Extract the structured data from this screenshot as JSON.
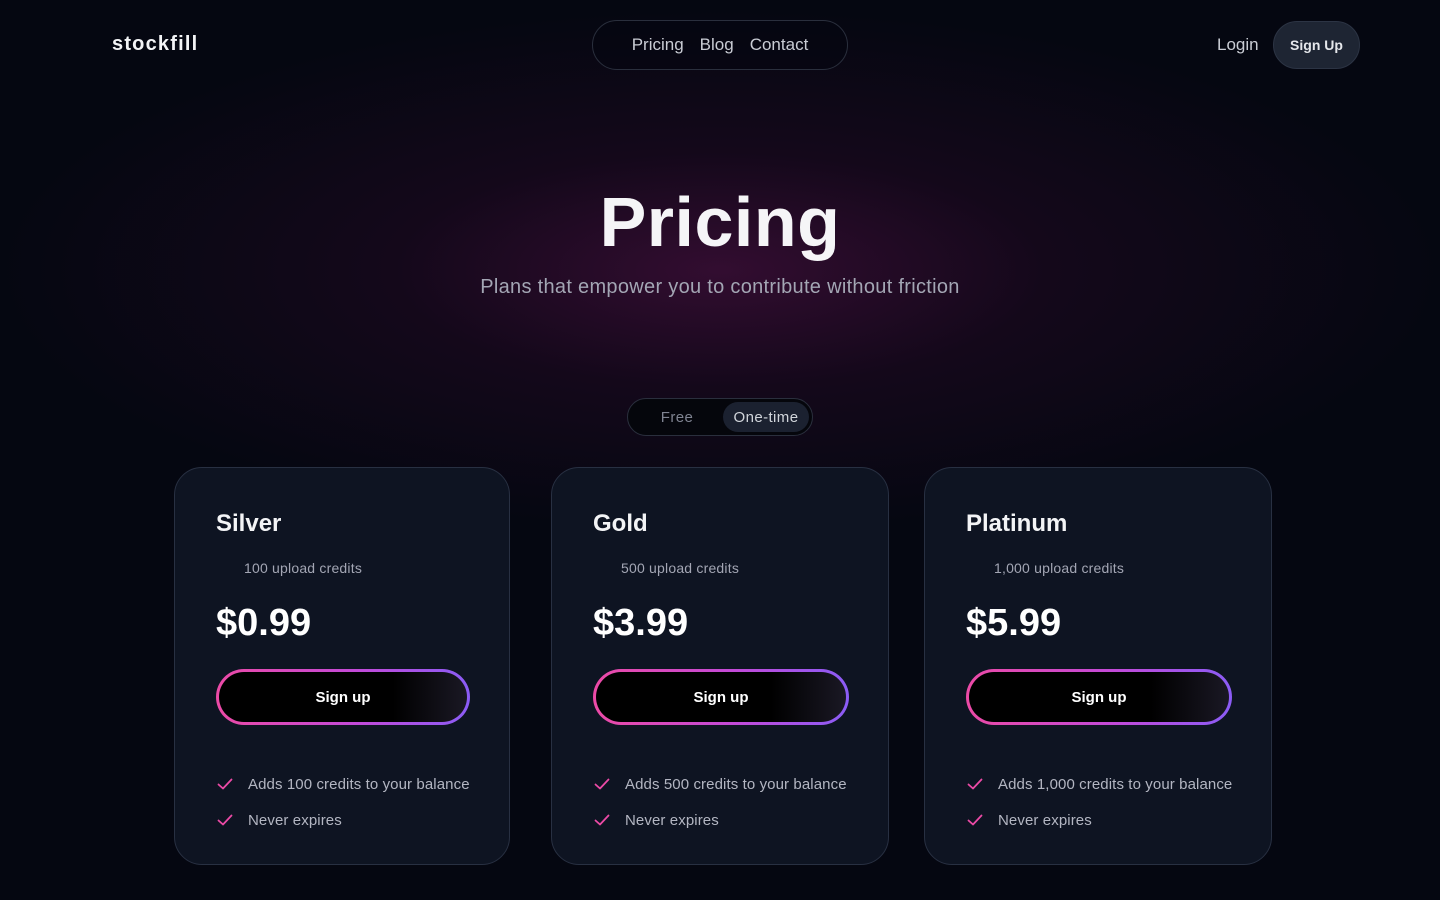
{
  "header": {
    "logo": "stockfill",
    "nav": [
      {
        "label": "Pricing"
      },
      {
        "label": "Blog"
      },
      {
        "label": "Contact"
      }
    ],
    "login_label": "Login",
    "signup_label": "Sign Up"
  },
  "hero": {
    "title": "Pricing",
    "subtitle": "Plans that empower you to contribute without friction"
  },
  "toggle": {
    "options": [
      "Free",
      "One-time"
    ],
    "selected": "One-time"
  },
  "plans": [
    {
      "name": "Silver",
      "credits": "100 upload credits",
      "price": "$0.99",
      "cta": "Sign up",
      "features": [
        "Adds 100 credits to your balance",
        "Never expires"
      ]
    },
    {
      "name": "Gold",
      "credits": "500 upload credits",
      "price": "$3.99",
      "cta": "Sign up",
      "features": [
        "Adds 500 credits to your balance",
        "Never expires"
      ]
    },
    {
      "name": "Platinum",
      "credits": "1,000 upload credits",
      "price": "$5.99",
      "cta": "Sign up",
      "features": [
        "Adds 1,000 credits to your balance",
        "Never expires"
      ]
    }
  ],
  "colors": {
    "background": "#050711",
    "card": "#0e1422",
    "accent_pink": "#ec4aa6",
    "accent_purple": "#8b5cf6"
  },
  "icons": {
    "feature": "check-icon"
  }
}
